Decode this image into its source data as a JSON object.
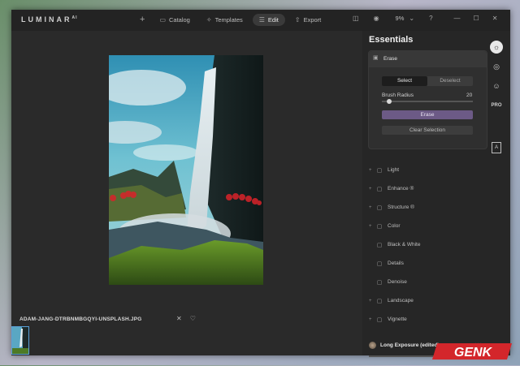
{
  "app": {
    "logo": "LUMINAR",
    "logo_sup": "AI"
  },
  "nav": {
    "add_icon": "plus-icon",
    "catalog": "Catalog",
    "templates": "Templates",
    "edit": "Edit",
    "export": "Export"
  },
  "toolbar": {
    "zoom": "9%"
  },
  "panel": {
    "title": "Essentials",
    "erase": {
      "header": "Erase",
      "select": "Select",
      "deselect": "Deselect",
      "brush_label": "Brush Radius",
      "brush_value": "20",
      "brush_fraction": 0.08,
      "erase_button": "Erase",
      "clear_button": "Clear Selection"
    },
    "tools": [
      {
        "label": "Light",
        "expand": "+",
        "icon": "sun-icon"
      },
      {
        "label": "Enhance ®",
        "expand": "+",
        "icon": "enhance-icon"
      },
      {
        "label": "Structure ®",
        "expand": "+",
        "icon": "structure-icon"
      },
      {
        "label": "Color",
        "expand": "+",
        "icon": "color-icon"
      },
      {
        "label": "Black & White",
        "expand": "",
        "icon": "bw-icon"
      },
      {
        "label": "Details",
        "expand": "",
        "icon": "details-icon"
      },
      {
        "label": "Denoise",
        "expand": "",
        "icon": "denoise-icon"
      },
      {
        "label": "Landscape",
        "expand": "+",
        "icon": "landscape-icon"
      },
      {
        "label": "Vignette",
        "expand": "+",
        "icon": "vignette-icon"
      }
    ],
    "preset": {
      "name": "Long Exposure (edited)",
      "more": "•••"
    }
  },
  "sidebar": {
    "pro_label": "PRO",
    "letter": "A"
  },
  "canvas": {
    "filename": "ADAM-JANG-DTRBNMBGQYI-UNSPLASH.JPG"
  },
  "watermark": {
    "text": "GENK"
  }
}
